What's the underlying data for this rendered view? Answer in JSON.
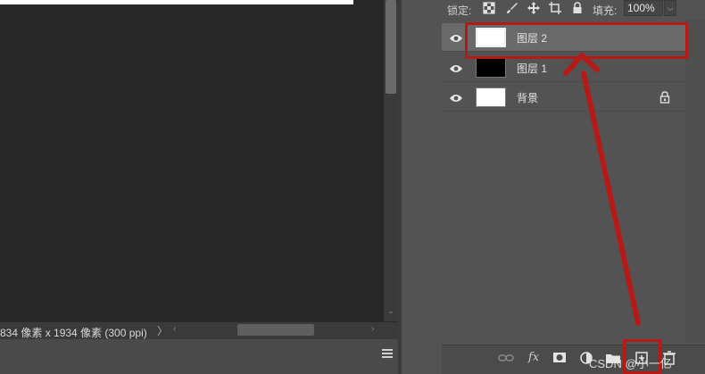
{
  "status_bar": {
    "document_size": "834 像素 x 1934 像素 (300 ppi)",
    "arrow": "〉"
  },
  "layers_panel": {
    "lock_label": "锁定:",
    "fill_label": "填充:",
    "fill_value": "100%",
    "layers": [
      {
        "name": "图层 2",
        "thumbnail_color": "#ffffff",
        "visible": true,
        "selected": true,
        "locked": false
      },
      {
        "name": "图层 1",
        "thumbnail_color": "#000000",
        "visible": true,
        "selected": false,
        "locked": false
      },
      {
        "name": "背景",
        "thumbnail_color": "#ffffff",
        "visible": true,
        "selected": false,
        "locked": true
      }
    ],
    "footer_icons": [
      "link-icon",
      "fx-icon",
      "mask-icon",
      "adjustment-icon",
      "folder-icon",
      "new-layer-icon",
      "trash-icon"
    ],
    "fx_label": "fx"
  },
  "annotation": {
    "color": "#b51b16",
    "target_layer": "图层 2",
    "target_button": "new-layer-icon"
  },
  "watermark": "CSDN @小一亿",
  "colors": {
    "canvas_bg": "#282828",
    "panel_bg": "#535353",
    "selected_row": "#6a6a6a",
    "highlight_red": "#b51b16"
  }
}
